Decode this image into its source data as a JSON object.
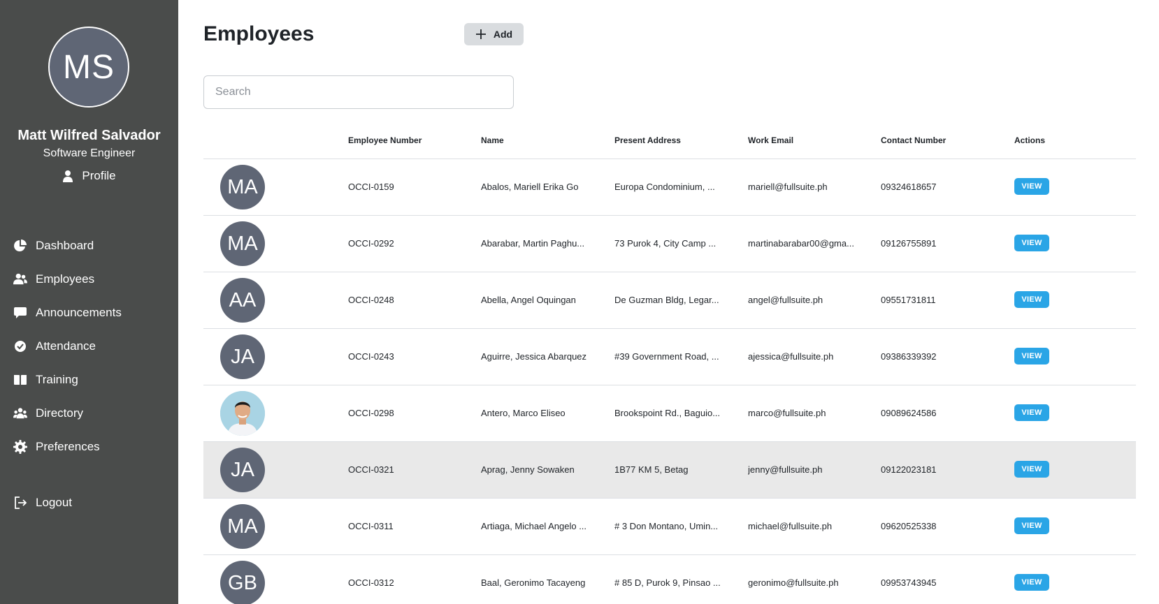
{
  "sidebar": {
    "avatar_initials": "MS",
    "user_name": "Matt Wilfred Salvador",
    "user_role": "Software Engineer",
    "profile_label": "Profile",
    "nav": [
      {
        "label": "Dashboard",
        "icon": "pie-chart-icon"
      },
      {
        "label": "Employees",
        "icon": "users-icon"
      },
      {
        "label": "Announcements",
        "icon": "chat-bubble-icon"
      },
      {
        "label": "Attendance",
        "icon": "check-circle-icon"
      },
      {
        "label": "Training",
        "icon": "book-icon"
      },
      {
        "label": "Directory",
        "icon": "people-group-icon"
      },
      {
        "label": "Preferences",
        "icon": "gear-icon"
      }
    ],
    "logout_label": "Logout"
  },
  "main": {
    "title": "Employees",
    "add_label": "Add",
    "search_placeholder": "Search",
    "columns": [
      "Employee Number",
      "Name",
      "Present Address",
      "Work Email",
      "Contact Number",
      "Actions"
    ],
    "view_label": "VIEW",
    "rows": [
      {
        "initials": "MA",
        "number": "OCCI-0159",
        "name": "Abalos, Mariell Erika Go",
        "address": "Europa Condominium, ...",
        "email": "mariell@fullsuite.ph",
        "contact": "09324618657"
      },
      {
        "initials": "MA",
        "number": "OCCI-0292",
        "name": "Abarabar, Martin Paghu...",
        "address": "73 Purok 4, City Camp ...",
        "email": "martinabarabar00@gma...",
        "contact": "09126755891"
      },
      {
        "initials": "AA",
        "number": "OCCI-0248",
        "name": "Abella, Angel Oquingan",
        "address": "De Guzman Bldg, Legar...",
        "email": "angel@fullsuite.ph",
        "contact": "09551731811"
      },
      {
        "initials": "JA",
        "number": "OCCI-0243",
        "name": "Aguirre, Jessica Abarquez",
        "address": "#39 Government Road, ...",
        "email": "ajessica@fullsuite.ph",
        "contact": "09386339392"
      },
      {
        "initials": "",
        "photo": true,
        "number": "OCCI-0298",
        "name": "Antero, Marco Eliseo",
        "address": "Brookspoint Rd., Baguio...",
        "email": "marco@fullsuite.ph",
        "contact": "09089624586"
      },
      {
        "initials": "JA",
        "number": "OCCI-0321",
        "name": "Aprag, Jenny Sowaken",
        "address": "1B77 KM 5, Betag",
        "email": "jenny@fullsuite.ph",
        "contact": "09122023181",
        "highlighted": true
      },
      {
        "initials": "MA",
        "number": "OCCI-0311",
        "name": "Artiaga, Michael Angelo ...",
        "address": "# 3 Don Montano, Umin...",
        "email": "michael@fullsuite.ph",
        "contact": "09620525338"
      },
      {
        "initials": "GB",
        "number": "OCCI-0312",
        "name": "Baal, Geronimo Tacayeng",
        "address": "# 85 D, Purok 9, Pinsao ...",
        "email": "geronimo@fullsuite.ph",
        "contact": "09953743945"
      }
    ]
  },
  "colors": {
    "sidebar_bg": "#4a4c4b",
    "avatar_bg": "#5f6675",
    "view_button": "#2aa5e6",
    "highlight_row": "#e9e9e9"
  }
}
